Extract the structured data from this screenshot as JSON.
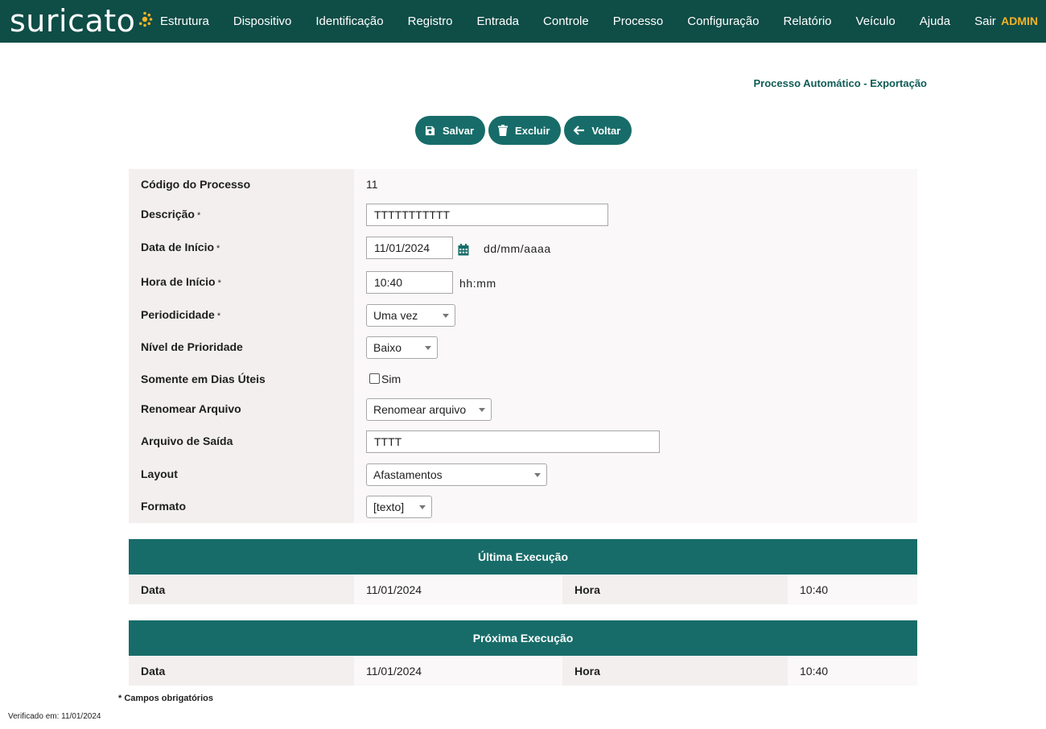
{
  "brand": {
    "logo_text": "suricato",
    "accent_color": "#f5b324",
    "bar_color": "#0f4d47",
    "primary_color": "#176c69"
  },
  "nav": {
    "items": [
      "Estrutura",
      "Dispositivo",
      "Identificação",
      "Registro",
      "Entrada",
      "Controle",
      "Processo",
      "Configuração",
      "Relatório",
      "Veículo",
      "Ajuda",
      "Sair"
    ],
    "user": "ADMIN"
  },
  "page": {
    "title": "Processo Automático - Exportação"
  },
  "toolbar": {
    "save_label": "Salvar",
    "delete_label": "Excluir",
    "back_label": "Voltar"
  },
  "form": {
    "codigo": {
      "label": "Código do Processo",
      "value": "11"
    },
    "descricao": {
      "label": "Descrição",
      "required": "*",
      "value": "TTTTTTTTTTT"
    },
    "data_inicio": {
      "label": "Data de Início",
      "required": "*",
      "value": "11/01/2024",
      "hint": "dd/mm/aaaa"
    },
    "hora_inicio": {
      "label": "Hora de Início",
      "required": "*",
      "value": "10:40",
      "hint": "hh:mm"
    },
    "periodicidade": {
      "label": "Periodicidade",
      "required": "*",
      "selected": "Uma vez"
    },
    "prioridade": {
      "label": "Nível de Prioridade",
      "selected": "Baixo"
    },
    "dias_uteis": {
      "label": "Somente em Dias Úteis",
      "option_label": "Sim",
      "checked": false
    },
    "renomear": {
      "label": "Renomear Arquivo",
      "selected": "Renomear arquivo"
    },
    "arquivo_saida": {
      "label": "Arquivo de Saída",
      "value": "TTTT"
    },
    "layout": {
      "label": "Layout",
      "selected": "Afastamentos"
    },
    "formato": {
      "label": "Formato",
      "selected": "[texto]"
    }
  },
  "ultima_execucao": {
    "title": "Última Execução",
    "data_label": "Data",
    "data_value": "11/01/2024",
    "hora_label": "Hora",
    "hora_value": "10:40"
  },
  "proxima_execucao": {
    "title": "Próxima Execução",
    "data_label": "Data",
    "data_value": "11/01/2024",
    "hora_label": "Hora",
    "hora_value": "10:40"
  },
  "footer": {
    "required_note": "* Campos obrigatórios",
    "verified": "Verificado em: 11/01/2024"
  }
}
